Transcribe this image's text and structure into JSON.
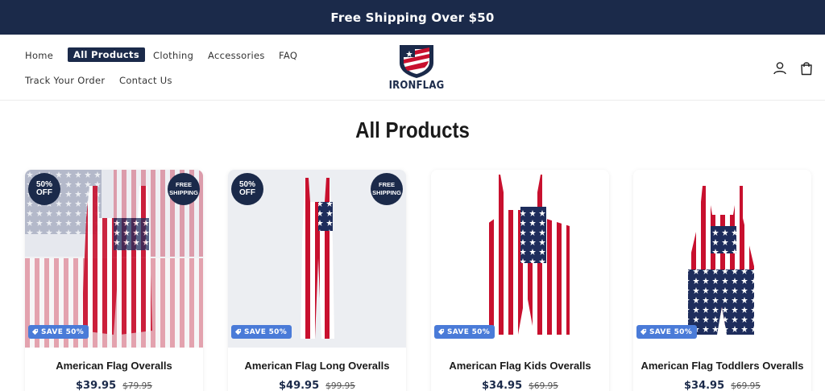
{
  "announcement": {
    "text": "Free Shipping Over $50"
  },
  "nav": {
    "items": [
      {
        "label": "Home"
      },
      {
        "label": "All Products"
      },
      {
        "label": "Clothing"
      },
      {
        "label": "Accessories"
      },
      {
        "label": "FAQ"
      },
      {
        "label": "Track Your Order"
      },
      {
        "label": "Contact Us"
      }
    ]
  },
  "brand": {
    "name": "IRONFLAG"
  },
  "header_icons": {
    "account": "user-icon",
    "cart": "shopping-bag-icon"
  },
  "page": {
    "title": "All Products"
  },
  "products": [
    {
      "name": "American Flag Overalls",
      "price": "$39.95",
      "compare_price": "$79.95",
      "badge_off": "50% OFF",
      "badge_ship": "FREE SHIPPING",
      "save_label": "SAVE 50%"
    },
    {
      "name": "American Flag Long Overalls",
      "price": "$49.95",
      "compare_price": "$99.95",
      "badge_off": "50% OFF",
      "badge_ship": "FREE SHIPPING",
      "save_label": "SAVE 50%"
    },
    {
      "name": "American Flag Kids Overalls",
      "price": "$34.95",
      "compare_price": "$69.95",
      "save_label": "SAVE 50%"
    },
    {
      "name": "American Flag Toddlers Overalls",
      "price": "$34.95",
      "compare_price": "$69.95",
      "save_label": "SAVE 50%"
    }
  ],
  "colors": {
    "navy": "#1b2a4a",
    "red": "#c8102e",
    "save_blue": "#4a7bd8"
  }
}
